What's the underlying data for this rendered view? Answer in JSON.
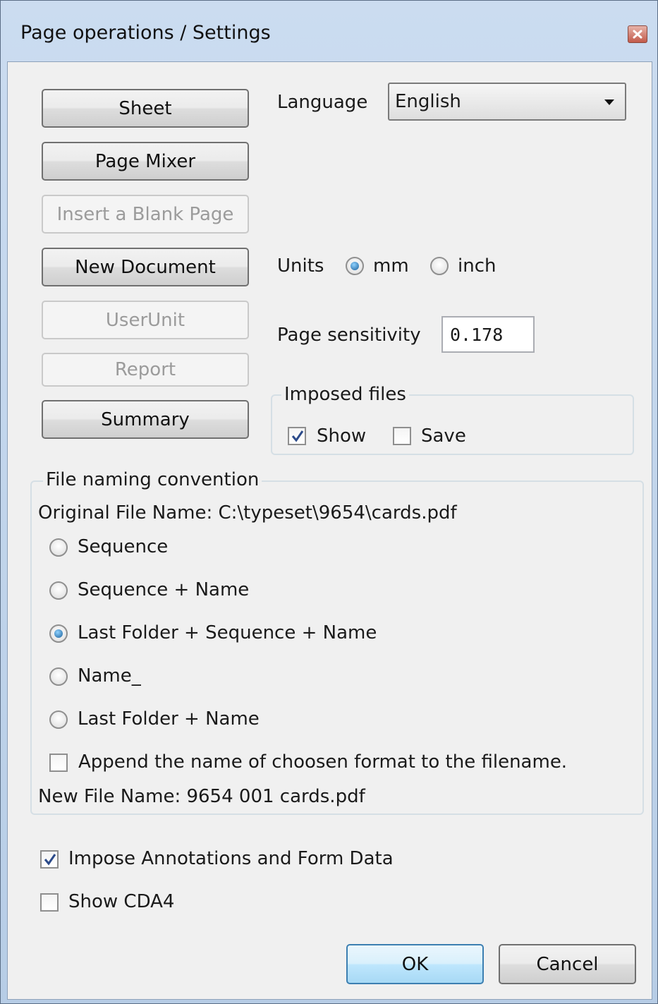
{
  "window": {
    "title": "Page operations / Settings"
  },
  "buttons": {
    "sheet": "Sheet",
    "page_mixer": "Page Mixer",
    "insert_blank_page": "Insert a Blank Page",
    "new_document": "New Document",
    "user_unit": "UserUnit",
    "report": "Report",
    "summary": "Summary",
    "ok": "OK",
    "cancel": "Cancel"
  },
  "language": {
    "label": "Language",
    "value": "English"
  },
  "units": {
    "label": "Units",
    "options": [
      "mm",
      "inch"
    ],
    "selected": "mm"
  },
  "page_sensitivity": {
    "label": "Page sensitivity",
    "value": "0.178"
  },
  "imposed_files": {
    "title": "Imposed files",
    "show": {
      "label": "Show",
      "checked": true
    },
    "save": {
      "label": "Save",
      "checked": false
    }
  },
  "file_naming": {
    "title": "File naming convention",
    "original": "Original File Name: C:\\typeset\\9654\\cards.pdf",
    "options": [
      "Sequence",
      "Sequence + Name",
      "Last Folder + Sequence + Name",
      "Name_",
      "Last Folder + Name"
    ],
    "selected_index": 2,
    "append_format": {
      "label": "Append the name of choosen format to the filename.",
      "checked": false
    },
    "new_name": "New File Name: 9654 001 cards.pdf"
  },
  "impose_annotations": {
    "label": "Impose Annotations and Form Data",
    "checked": true
  },
  "show_cda4": {
    "label": "Show CDA4",
    "checked": false
  },
  "colors": {
    "accent": "#3c7fb1",
    "window_frame": "#bfcfe2",
    "client_bg": "#f0f0f0"
  },
  "icons": {
    "close": "close-icon",
    "dropdown": "chevron-down-icon",
    "check": "checkmark-icon"
  }
}
